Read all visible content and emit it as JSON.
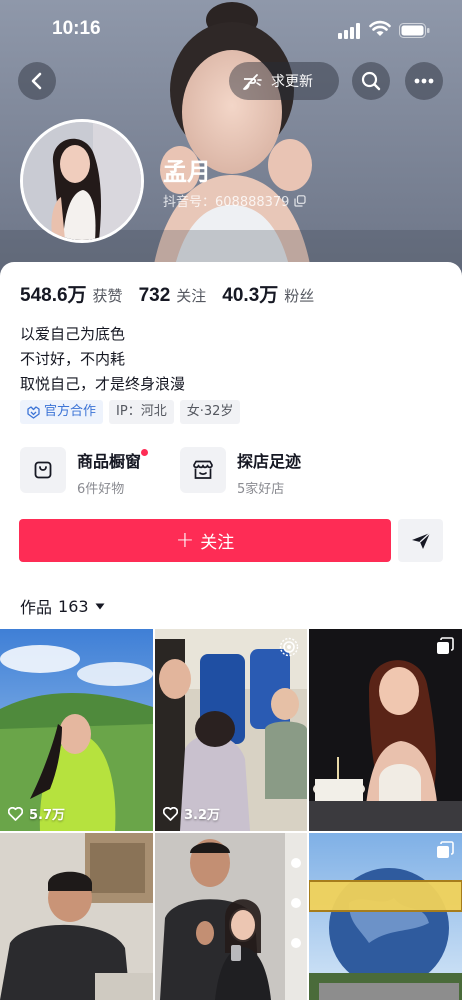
{
  "status_bar": {
    "time": "10:16"
  },
  "header": {
    "update_label": "求更新"
  },
  "profile": {
    "name": "孟月",
    "douyin_id": "抖音号：608888379"
  },
  "stats": [
    {
      "value": "548.6万",
      "label": "获赞"
    },
    {
      "value": "732",
      "label": "关注"
    },
    {
      "value": "40.3万",
      "label": "粉丝"
    }
  ],
  "bio": [
    "以爱自己为底色",
    "不讨好，不内耗",
    "取悦自己，才是终身浪漫"
  ],
  "tags": {
    "official": "官方合作",
    "ip": "IP：河北",
    "gender_age": "女·32岁"
  },
  "entries": [
    {
      "title": "商品橱窗",
      "sub": "6件好物",
      "icon": "shop-bag-icon",
      "has_dot": true
    },
    {
      "title": "探店足迹",
      "sub": "5家好店",
      "icon": "store-icon",
      "has_dot": false
    }
  ],
  "actions": {
    "follow_label": "关注",
    "share_icon": "paper-plane-icon"
  },
  "works": {
    "label": "作品",
    "count": "163"
  },
  "videos": [
    {
      "likes": "5.7万",
      "badge": ""
    },
    {
      "likes": "3.2万",
      "badge": "live-photo-icon"
    },
    {
      "likes": "",
      "badge": "multi-image-icon"
    },
    {
      "likes": "",
      "badge": ""
    },
    {
      "likes": "",
      "badge": ""
    },
    {
      "likes": "",
      "badge": "multi-image-icon"
    }
  ],
  "colors": {
    "accent": "#fe2c55",
    "official_blue": "#3c74d6",
    "text": "#161823"
  }
}
